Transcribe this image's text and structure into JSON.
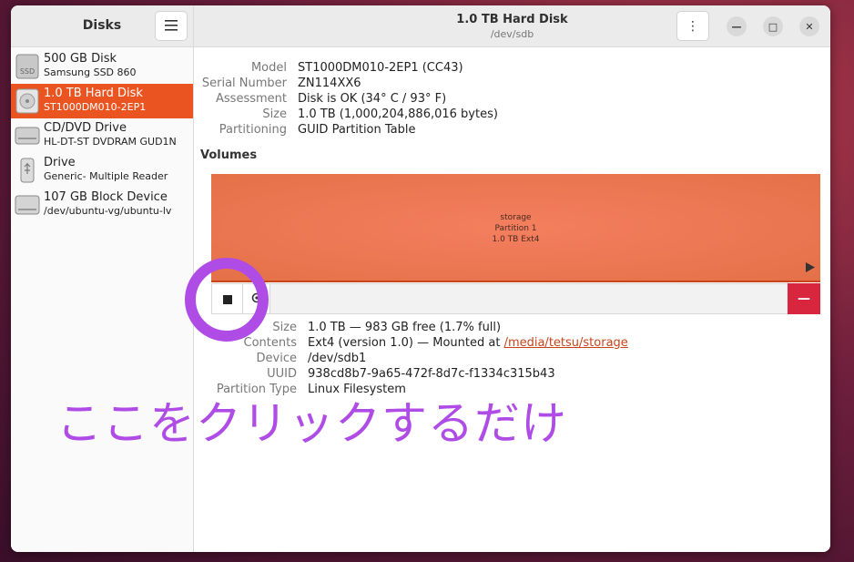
{
  "sidebar": {
    "title": "Disks",
    "menu_icon": "hamburger-icon",
    "items": [
      {
        "name": "500 GB Disk",
        "sub": "Samsung SSD 860",
        "icon": "ssd-icon",
        "icon_text": "SSD"
      },
      {
        "name": "1.0 TB Hard Disk",
        "sub": "ST1000DM010-2EP1",
        "icon": "hard-disk-icon",
        "selected": true
      },
      {
        "name": "CD/DVD Drive",
        "sub": "HL-DT-ST DVDRAM GUD1N",
        "icon": "optical-drive-icon"
      },
      {
        "name": "Drive",
        "sub": "Generic- Multiple Reader",
        "icon": "usb-drive-icon"
      },
      {
        "name": "107 GB Block Device",
        "sub": "/dev/ubuntu-vg/ubuntu-lv",
        "icon": "block-device-icon"
      }
    ]
  },
  "header": {
    "title": "1.0 TB Hard Disk",
    "subtitle": "/dev/sdb",
    "kebab_label": "⋮",
    "minimize_label": "—",
    "maximize_label": "□",
    "close_label": "✕"
  },
  "drive_info": [
    {
      "label": "Model",
      "value": "ST1000DM010-2EP1 (CC43)"
    },
    {
      "label": "Serial Number",
      "value": "ZN114XX6"
    },
    {
      "label": "Assessment",
      "value": "Disk is OK (34° C / 93° F)"
    },
    {
      "label": "Size",
      "value": "1.0 TB (1,000,204,886,016 bytes)"
    },
    {
      "label": "Partitioning",
      "value": "GUID Partition Table"
    }
  ],
  "volumes": {
    "title": "Volumes",
    "partition": {
      "name": "storage",
      "number": "Partition 1",
      "desc": "1.0 TB Ext4"
    },
    "delete_label": "—"
  },
  "volume_info": {
    "size_label": "Size",
    "size_value": "1.0 TB — 983 GB free (1.7% full)",
    "contents_label": "Contents",
    "contents_prefix": "Ext4 (version 1.0) — Mounted at ",
    "contents_link": "/media/tetsu/storage",
    "device_label": "Device",
    "device_value": "/dev/sdb1",
    "uuid_label": "UUID",
    "uuid_value": "938cd8b7-9a65-472f-8d7c-f1334c315b43",
    "ptype_label": "Partition Type",
    "ptype_value": "Linux Filesystem"
  },
  "annotation": {
    "text": "ここをクリックするだけ",
    "color": "#b04ce6"
  },
  "colors": {
    "accent": "#e95420",
    "delete": "#d7263d",
    "annotation": "#b04ce6"
  }
}
